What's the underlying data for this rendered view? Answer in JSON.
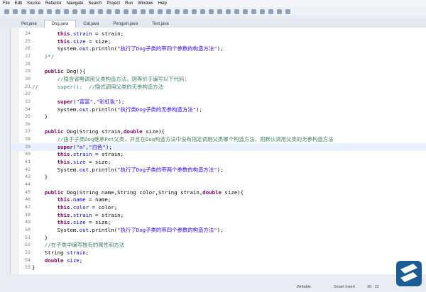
{
  "menu": [
    "File",
    "Edit",
    "Source",
    "Refactor",
    "Navigate",
    "Search",
    "Project",
    "Run",
    "Window",
    "Help"
  ],
  "tabs": [
    {
      "label": "Pet.java",
      "active": false
    },
    {
      "label": "Dog.java",
      "active": true
    },
    {
      "label": "Cat.java",
      "active": false
    },
    {
      "label": "Penguin.java",
      "active": false
    },
    {
      "label": "Test.java",
      "active": false
    }
  ],
  "lines": [
    {
      "n": "24",
      "segs": [
        [
          "kw",
          "        this"
        ],
        [
          "pl",
          "."
        ],
        [
          "fld",
          "strain"
        ],
        [
          "pl",
          " = strain;"
        ]
      ]
    },
    {
      "n": "25",
      "segs": [
        [
          "kw",
          "        this"
        ],
        [
          "pl",
          "."
        ],
        [
          "fld",
          "size"
        ],
        [
          "pl",
          " = size;"
        ]
      ]
    },
    {
      "n": "26",
      "segs": [
        [
          "pl",
          "        System."
        ],
        [
          "fld",
          "out"
        ],
        [
          "pl",
          ".println("
        ],
        [
          "str",
          "\"执行了Dog子类的带四个参数的构造方法\""
        ],
        [
          "pl",
          ");"
        ]
      ]
    },
    {
      "n": "27",
      "segs": [
        [
          "cmt",
          "    }*/"
        ]
      ]
    },
    {
      "n": "28",
      "segs": []
    },
    {
      "n": "29",
      "segs": [
        [
          "kw",
          "    public"
        ],
        [
          "pl",
          " Dog(){"
        ]
      ]
    },
    {
      "n": "30",
      "segs": [
        [
          "cmt",
          "        //隐含省略调用父类构造方法，则等价于编写以下代码："
        ]
      ]
    },
    {
      "n": "31",
      "segs": [
        [
          "cmt",
          "//      super();  //隐式调用父类的无参构造方法"
        ]
      ]
    },
    {
      "n": "32",
      "segs": []
    },
    {
      "n": "33",
      "segs": [
        [
          "kw",
          "        super"
        ],
        [
          "pl",
          "("
        ],
        [
          "str",
          "\"富富\""
        ],
        [
          "pl",
          ","
        ],
        [
          "str",
          "\"彩虹色\""
        ],
        [
          "pl",
          ");"
        ]
      ]
    },
    {
      "n": "34",
      "segs": [
        [
          "pl",
          "        System."
        ],
        [
          "fld",
          "out"
        ],
        [
          "pl",
          ".println("
        ],
        [
          "str",
          "\"执行类Dog子类的无参构造方法\""
        ],
        [
          "pl",
          ");"
        ]
      ]
    },
    {
      "n": "35",
      "segs": [
        [
          "pl",
          "    }"
        ]
      ]
    },
    {
      "n": "36",
      "segs": []
    },
    {
      "n": "37",
      "segs": [
        [
          "kw",
          "    public"
        ],
        [
          "pl",
          " Dog("
        ],
        [
          "pl",
          "String strain,"
        ],
        [
          "kw",
          "double"
        ],
        [
          "pl",
          " size){"
        ]
      ]
    },
    {
      "n": "38",
      "segs": [
        [
          "cmt",
          "        //由于子类Dog继承Pet父类，并且在Dog构造方法中没有指定调用父类哪个构造方法，则默认调用父类的无参构造方法"
        ]
      ]
    },
    {
      "n": "39",
      "cur": true,
      "segs": [
        [
          "kw",
          "        super"
        ],
        [
          "pl",
          "("
        ],
        [
          "str",
          "\"a\""
        ],
        [
          "pl",
          ","
        ],
        [
          "str",
          "\"白色\""
        ],
        [
          "pl",
          ");"
        ]
      ]
    },
    {
      "n": "40",
      "segs": [
        [
          "kw",
          "        this"
        ],
        [
          "pl",
          "."
        ],
        [
          "fld",
          "strain"
        ],
        [
          "pl",
          " = strain;"
        ]
      ]
    },
    {
      "n": "41",
      "segs": [
        [
          "kw",
          "        this"
        ],
        [
          "pl",
          "."
        ],
        [
          "fld",
          "size"
        ],
        [
          "pl",
          " = size;"
        ]
      ]
    },
    {
      "n": "42",
      "segs": [
        [
          "pl",
          "        System."
        ],
        [
          "fld",
          "out"
        ],
        [
          "pl",
          ".println("
        ],
        [
          "str",
          "\"执行了Dog子类的带两个参数的构造方法\""
        ],
        [
          "pl",
          ");"
        ]
      ]
    },
    {
      "n": "43",
      "segs": [
        [
          "pl",
          "    }"
        ]
      ]
    },
    {
      "n": "44",
      "segs": []
    },
    {
      "n": "45",
      "segs": [
        [
          "kw",
          "    public"
        ],
        [
          "pl",
          " Dog(String name,String color,String strain,"
        ],
        [
          "kw",
          "double"
        ],
        [
          "pl",
          " size){"
        ]
      ]
    },
    {
      "n": "46",
      "segs": [
        [
          "kw",
          "        this"
        ],
        [
          "pl",
          "."
        ],
        [
          "fld",
          "name"
        ],
        [
          "pl",
          " = name;"
        ]
      ]
    },
    {
      "n": "47",
      "segs": [
        [
          "kw",
          "        this"
        ],
        [
          "pl",
          "."
        ],
        [
          "fld",
          "color"
        ],
        [
          "pl",
          " = color;"
        ]
      ]
    },
    {
      "n": "48",
      "segs": [
        [
          "kw",
          "        this"
        ],
        [
          "pl",
          "."
        ],
        [
          "fld",
          "strain"
        ],
        [
          "pl",
          " = strain;"
        ]
      ]
    },
    {
      "n": "49",
      "segs": [
        [
          "kw",
          "        this"
        ],
        [
          "pl",
          "."
        ],
        [
          "fld",
          "size"
        ],
        [
          "pl",
          " = size;"
        ]
      ]
    },
    {
      "n": "50",
      "segs": [
        [
          "pl",
          "        System."
        ],
        [
          "fld",
          "out"
        ],
        [
          "pl",
          ".println("
        ],
        [
          "str",
          "\"执行了Dog子类的带四个参数的构造方法\""
        ],
        [
          "pl",
          ");"
        ]
      ]
    },
    {
      "n": "51",
      "segs": [
        [
          "pl",
          "    }"
        ]
      ]
    },
    {
      "n": "52",
      "segs": [
        [
          "cmt",
          "    //在子类中编写独有的属性和方法"
        ]
      ]
    },
    {
      "n": "53",
      "segs": [
        [
          "pl",
          "    String "
        ],
        [
          "fld",
          "strain"
        ],
        [
          "pl",
          ";"
        ]
      ]
    },
    {
      "n": "54",
      "segs": [
        [
          "kw",
          "    double"
        ],
        [
          "pl",
          " "
        ],
        [
          "fld",
          "size"
        ],
        [
          "pl",
          ";"
        ]
      ]
    },
    {
      "n": "55",
      "segs": [
        [
          "pl",
          "}"
        ]
      ]
    }
  ],
  "status": {
    "writable": "Writable",
    "insert": "Smart Insert",
    "position": "39 : 22"
  }
}
